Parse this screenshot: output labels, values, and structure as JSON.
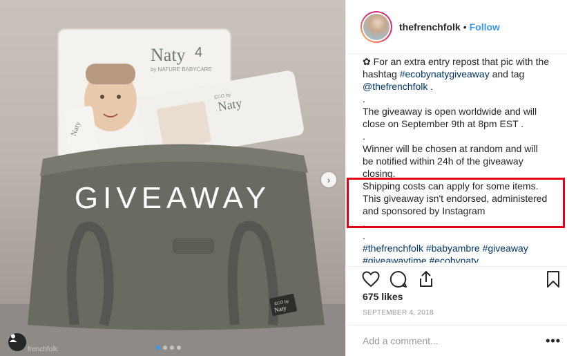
{
  "post": {
    "overlay_text": "GIVEAWAY",
    "photo_credit": "frenchfolk",
    "next_glyph": "›",
    "carousel": {
      "count": 4,
      "active_index": 0
    },
    "products": {
      "diaper_brand": "Naty",
      "diaper_sub": "by NATURE BABYCARE",
      "diaper_size": "4",
      "wipes_brand": "Naty",
      "wipes_prefix": "ECO by",
      "cream_brand": "Naty",
      "bag_tag_top": "ECO by",
      "bag_tag_brand": "Naty"
    }
  },
  "header": {
    "username": "thefrenchfolk",
    "separator": "•",
    "follow_label": "Follow"
  },
  "caption": {
    "line1_prefix": "✿ For an extra entry repost that pic with the hashtag ",
    "line1_hashtag": "#ecobynatygiveaway",
    "line1_mid": " and tag ",
    "line1_mention": "@thefrenchfolk",
    "line1_suffix": " .",
    "dot1": ".",
    "para2": "The giveaway  is open worldwide and will close on September 9th at 8pm EST .",
    "dot2": ".",
    "para3": "Winner will be chosen at random and will be notified within 24h of the giveaway closing.",
    "para4": "Shipping costs can apply for some items. This giveaway isn't endorsed, administered and sponsored by Instagram",
    "dot3": ".",
    "dot4": ".",
    "hashtags_line1": [
      "#thefrenchfolk",
      "#babyambre",
      "#giveaway"
    ],
    "hashtags_line2": [
      "#giveawaytime",
      "#ecobynaty"
    ]
  },
  "actions": {
    "like_icon": "heart-icon",
    "comment_icon": "comment-icon",
    "share_icon": "share-icon",
    "save_icon": "bookmark-icon"
  },
  "likes": "675 likes",
  "date": "SEPTEMBER 4, 2018",
  "comment": {
    "placeholder": "Add a comment...",
    "more_label": "•••"
  },
  "colors": {
    "link_blue": "#3897f0",
    "hashtag_blue": "#003569",
    "highlight_red": "#e0001a",
    "meta_gray": "#999999"
  }
}
